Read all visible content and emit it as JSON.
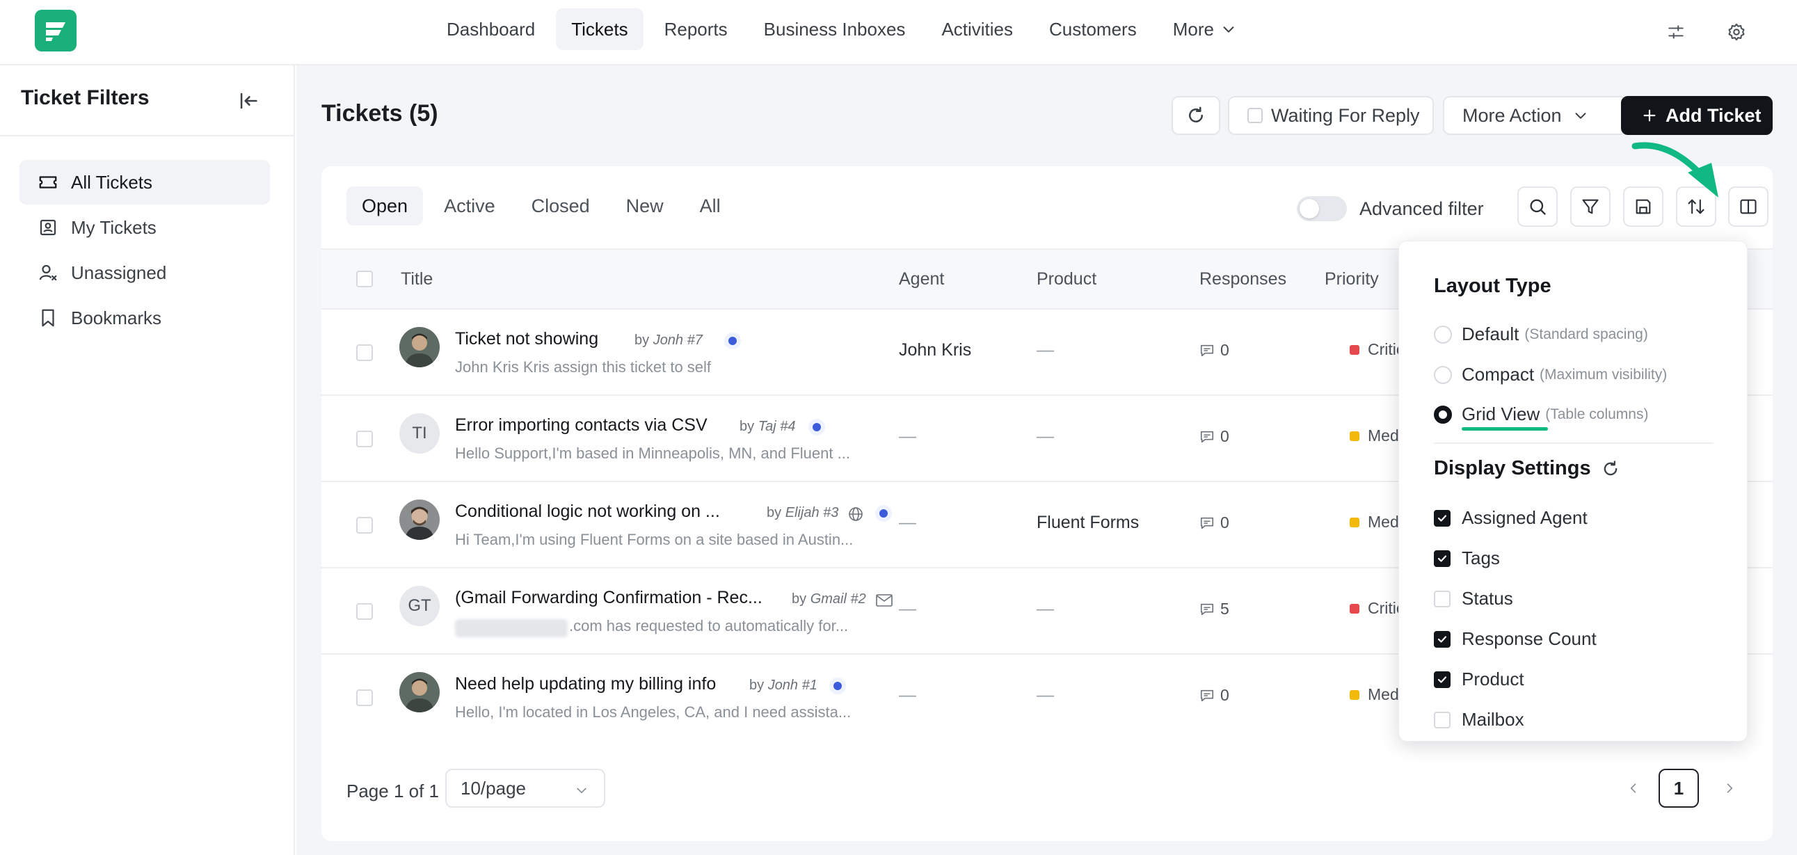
{
  "nav": {
    "items": [
      {
        "label": "Dashboard"
      },
      {
        "label": "Tickets"
      },
      {
        "label": "Reports"
      },
      {
        "label": "Business Inboxes"
      },
      {
        "label": "Activities"
      },
      {
        "label": "Customers"
      },
      {
        "label": "More"
      }
    ],
    "active_index": 1
  },
  "sidebar": {
    "title": "Ticket Filters",
    "items": [
      {
        "label": "All Tickets",
        "icon": "ticket-icon"
      },
      {
        "label": "My Tickets",
        "icon": "user-ticket-icon"
      },
      {
        "label": "Unassigned",
        "icon": "user-x-icon"
      },
      {
        "label": "Bookmarks",
        "icon": "bookmark-icon"
      }
    ]
  },
  "header": {
    "title": "Tickets (5)",
    "waiting_label": "Waiting For Reply",
    "more_action_label": "More Action",
    "add_ticket_label": "Add Ticket"
  },
  "tabs": [
    {
      "label": "Open"
    },
    {
      "label": "Active"
    },
    {
      "label": "Closed"
    },
    {
      "label": "New"
    },
    {
      "label": "All"
    }
  ],
  "advanced_filter_label": "Advanced filter",
  "table": {
    "columns": {
      "title": "Title",
      "agent": "Agent",
      "product": "Product",
      "responses": "Responses",
      "priority": "Priority"
    },
    "rows": [
      {
        "title": "Ticket not showing",
        "by": "by ",
        "author": "Jonh #7",
        "subtitle": "John Kris Kris assign this ticket to self",
        "agent": "John Kris",
        "product": "—",
        "responses": "0",
        "priority": "Critical",
        "avatar": "photo-1",
        "initials": ""
      },
      {
        "title": "Error importing contacts via CSV",
        "by": "by ",
        "author": "Taj #4",
        "subtitle": "Hello Support,I'm based in Minneapolis, MN, and Fluent ...",
        "agent": "—",
        "product": "—",
        "responses": "0",
        "priority": "Medium",
        "avatar": "initials",
        "initials": "TI"
      },
      {
        "title": "Conditional logic not working on ...",
        "by": "by ",
        "author": "Elijah #3",
        "subtitle": "Hi Team,I'm using Fluent Forms on a site based in Austin...",
        "agent": "—",
        "product": "Fluent Forms",
        "responses": "0",
        "priority": "Medium",
        "avatar": "photo-2",
        "initials": ""
      },
      {
        "title": "(Gmail Forwarding Confirmation - Rec...",
        "by": "by ",
        "author": "Gmail #2",
        "subtitle": ".com has requested to automatically for...",
        "agent": "—",
        "product": "—",
        "responses": "5",
        "priority": "Critical",
        "avatar": "initials",
        "initials": "GT"
      },
      {
        "title": "Need help updating my billing info",
        "by": "by ",
        "author": "Jonh #1",
        "subtitle": "Hello, I'm located in Los Angeles, CA, and I need assista...",
        "agent": "—",
        "product": "—",
        "responses": "0",
        "priority": "Medium",
        "avatar": "photo-1",
        "initials": ""
      }
    ]
  },
  "pagination": {
    "page_text": "Page 1 of 1",
    "per_page": "10/page",
    "current": "1"
  },
  "layout_popover": {
    "layout_type_title": "Layout Type",
    "options": [
      {
        "label": "Default",
        "hint": "(Standard spacing)",
        "selected": false
      },
      {
        "label": "Compact",
        "hint": "(Maximum visibility)",
        "selected": false
      },
      {
        "label": "Grid View",
        "hint": "(Table columns)",
        "selected": true
      }
    ],
    "display_settings_title": "Display Settings",
    "settings": [
      {
        "label": "Assigned Agent",
        "checked": true
      },
      {
        "label": "Tags",
        "checked": true
      },
      {
        "label": "Status",
        "checked": false
      },
      {
        "label": "Response Count",
        "checked": true
      },
      {
        "label": "Product",
        "checked": true
      },
      {
        "label": "Mailbox",
        "checked": false
      }
    ]
  },
  "colors": {
    "brand": "#19b07a",
    "critical": "#e5484d",
    "medium": "#f2b90c",
    "accent_green": "#10b981",
    "dark": "#111418"
  }
}
